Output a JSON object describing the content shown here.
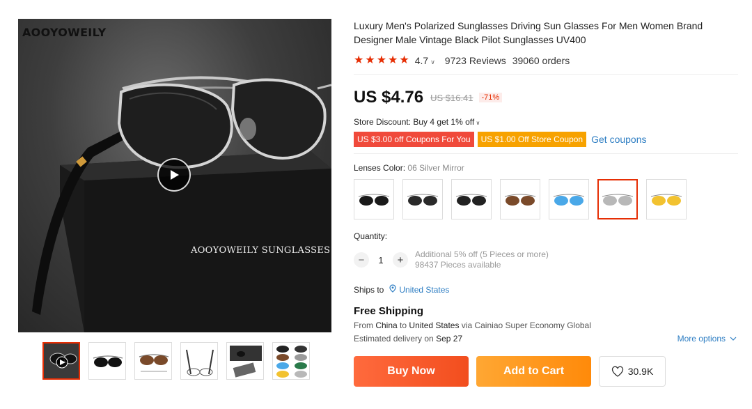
{
  "gallery": {
    "brand_watermark": "AOOYOWEILY",
    "box_caption": "AOOYOWEILY SUNGLASSES",
    "play_icon": "play-icon",
    "thumbnails": [
      {
        "name": "video-thumbnail",
        "active": true
      },
      {
        "name": "black-lens-thumbnail",
        "active": false
      },
      {
        "name": "brown-lens-thumbnail",
        "active": false
      },
      {
        "name": "folded-frame-thumbnail",
        "active": false
      },
      {
        "name": "packaging-thumbnail",
        "active": false
      },
      {
        "name": "color-grid-thumbnail",
        "active": false
      }
    ]
  },
  "product": {
    "title": "Luxury Men's Polarized Sunglasses Driving Sun Glasses For Men Women Brand Designer Male Vintage Black Pilot Sunglasses UV400",
    "rating": {
      "stars": 5,
      "value": "4.7",
      "reviews": "9723 Reviews",
      "orders": "39060 orders"
    },
    "price": "US $4.76",
    "original_price": "US $16.41",
    "discount_pct": "-71%",
    "store_discount": "Store Discount: Buy 4 get 1% off",
    "coupons": [
      "US $3.00 off Coupons For You",
      "US $1.00 Off Store Coupon"
    ],
    "get_coupons_label": "Get coupons"
  },
  "lenses": {
    "label": "Lenses Color:",
    "selected_value": "06 Silver Mirror",
    "options": [
      {
        "name": "lens-option-1",
        "tint": "#1a1a1a",
        "selected": false
      },
      {
        "name": "lens-option-2",
        "tint": "#2a2a2a",
        "selected": false
      },
      {
        "name": "lens-option-3",
        "tint": "#222222",
        "selected": false
      },
      {
        "name": "lens-option-4",
        "tint": "#7a4a2a",
        "selected": false
      },
      {
        "name": "lens-option-5",
        "tint": "#4aa8e8",
        "selected": false
      },
      {
        "name": "lens-option-6",
        "tint": "#b8b8b8",
        "selected": true
      },
      {
        "name": "lens-option-7",
        "tint": "#f2c230",
        "selected": false
      }
    ]
  },
  "quantity": {
    "label": "Quantity:",
    "value": "1",
    "note_1": "Additional 5% off (5 Pieces or more)",
    "note_2": "98437 Pieces available"
  },
  "shipping": {
    "ships_to_label": "Ships to",
    "ships_to_value": "United States",
    "title": "Free Shipping",
    "from_prefix": "From",
    "from": "China",
    "to_word": "to",
    "to": "United States",
    "via": "via Cainiao Super Economy Global",
    "delivery_prefix": "Estimated delivery on",
    "delivery_date": "Sep 27",
    "more_options": "More options"
  },
  "actions": {
    "buy_now": "Buy Now",
    "add_to_cart": "Add to Cart",
    "wishlist_count": "30.9K"
  },
  "colors": {
    "accent_red": "#e62e04",
    "link_blue": "#2e7ec3",
    "buy_orange": "#f24e1e",
    "cart_orange": "#ff8a0a"
  }
}
